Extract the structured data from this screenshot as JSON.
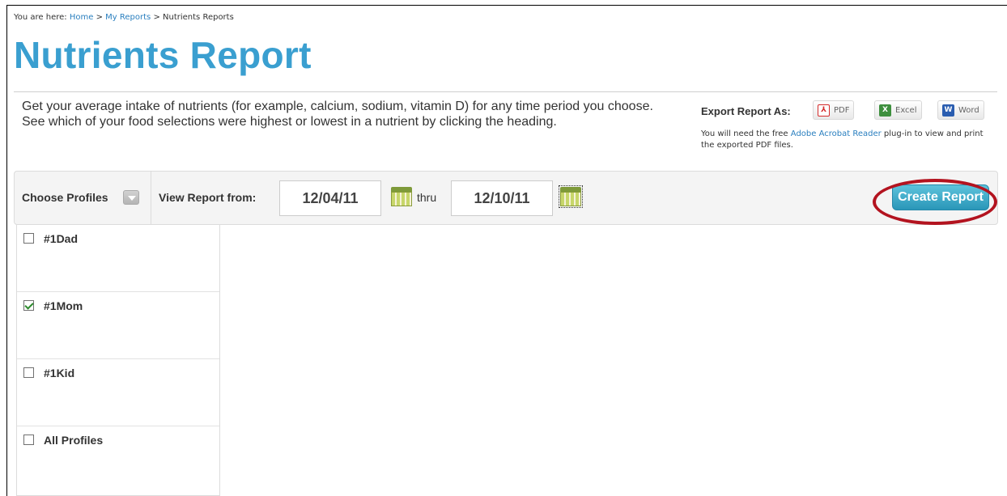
{
  "breadcrumb": {
    "prefix": "You are here:",
    "items": [
      "Home",
      "My Reports",
      "Nutrients Reports"
    ],
    "separator": ">"
  },
  "page_title": "Nutrients Report",
  "intro_text": "Get your average intake of nutrients (for example, calcium, sodium, vitamin D) for any time period you choose. See which of your food selections were highest or lowest in a nutrient by clicking the heading.",
  "export": {
    "label": "Export Report As:",
    "buttons": [
      {
        "label": "PDF",
        "icon": "pdf-icon"
      },
      {
        "label": "Excel",
        "icon": "excel-icon"
      },
      {
        "label": "Word",
        "icon": "word-icon"
      }
    ],
    "note_before": "You will need the free",
    "note_link": "Adobe Acrobat Reader",
    "note_after": "plug-in to view and print the exported PDF files."
  },
  "toolbar": {
    "choose_profiles": "Choose Profiles",
    "view_report_from": "View Report from:",
    "date_from": "12/04/11",
    "thru": "thru",
    "date_to": "12/10/11",
    "create_button": "Create Report"
  },
  "profiles": [
    {
      "label": "#1Dad",
      "checked": false
    },
    {
      "label": "#1Mom",
      "checked": true
    },
    {
      "label": "#1Kid",
      "checked": false
    },
    {
      "label": "All Profiles",
      "checked": false
    }
  ],
  "colors": {
    "title": "#3a9fd0",
    "link": "#2a7fbf",
    "create_button": "#2a96b8",
    "highlight_ring": "#b3131f"
  }
}
